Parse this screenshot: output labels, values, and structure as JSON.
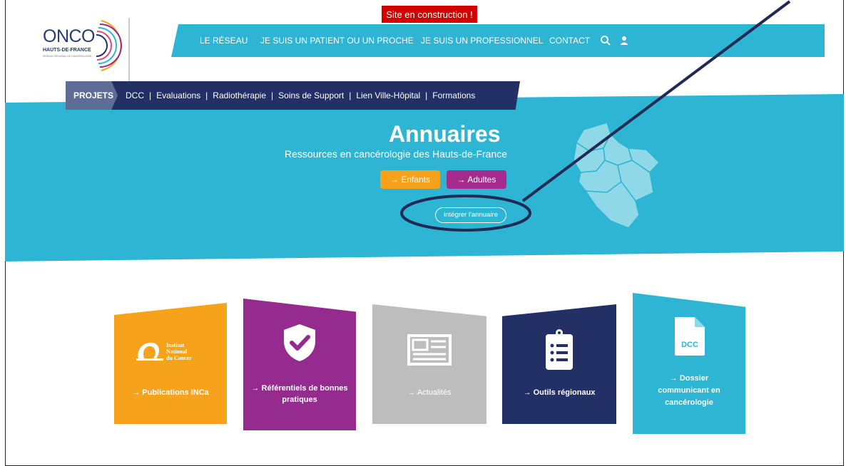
{
  "banner": "Site en construction !",
  "logo": {
    "title": "ONCO",
    "subtitle": "HAUTS-DE-FRANCE",
    "tagline": "RÉSEAU RÉGIONAL DE CANCÉROLOGIE"
  },
  "topnav": {
    "items": [
      "LE RÉSEAU",
      "JE SUIS UN PATIENT OU UN PROCHE",
      "JE SUIS UN PROFESSIONNEL",
      "CONTACT"
    ]
  },
  "subnav": {
    "active": "PROJETS",
    "links": [
      "DCC",
      "Evaluations",
      "Radiothérapie",
      "Soins de Support",
      "Lien Ville-Hôpital",
      "Formations"
    ],
    "separator": "|"
  },
  "hero": {
    "title": "Annuaires",
    "subtitle": "Ressources en cancérologie des Hauts-de-France",
    "btn_enfants": "→ Enfants",
    "btn_adultes": "→ Adultes",
    "btn_integrer": "intégrer l'annuaire"
  },
  "cards": [
    {
      "label": "→ Publications INCa",
      "logo_line1": "Institut",
      "logo_line2": "National",
      "logo_line3": "du Cancer"
    },
    {
      "label": "→ Référentiels de bonnes pratiques"
    },
    {
      "label": "→ Actualités"
    },
    {
      "label": "→ Outils régionaux"
    },
    {
      "label": "→ Dossier communicant en cancérologie",
      "doc_text": "DCC"
    }
  ],
  "colors": {
    "teal": "#2db5d3",
    "navy": "#233065",
    "orange": "#f7a21b",
    "purple": "#952a8f",
    "grey": "#bdbdbd",
    "red": "#d40000"
  }
}
